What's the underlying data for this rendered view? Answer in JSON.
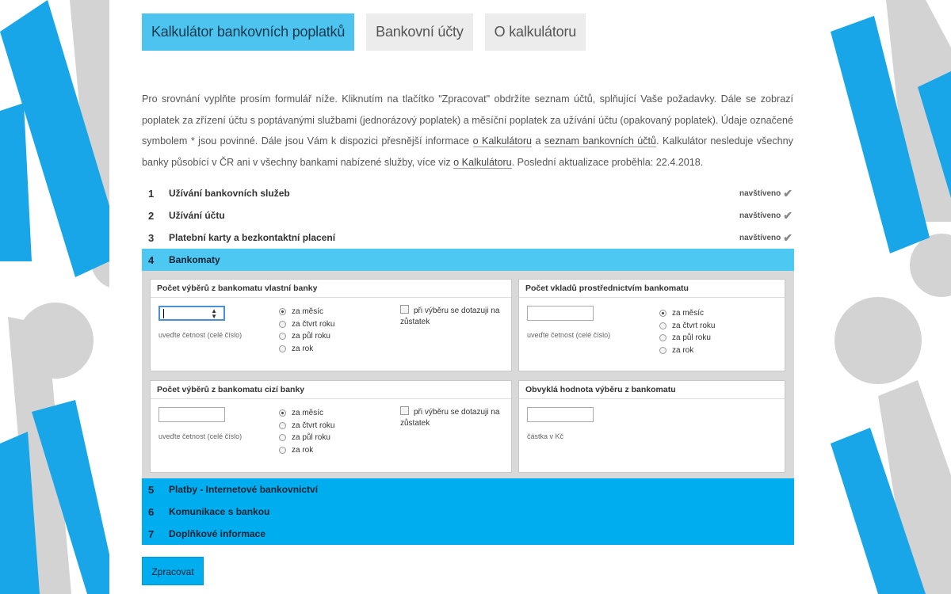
{
  "tabs": [
    {
      "label": "Kalkulátor bankovních poplatků"
    },
    {
      "label": "Bankovní účty"
    },
    {
      "label": "O kalkulátoru"
    }
  ],
  "intro": {
    "p1": "Pro srovnání vyplňte prosím formulář níže. Kliknutím na tlačítko \"Zpracovat\" obdržíte seznam účtů, splňující Vaše požadavky. Dále se zobrazí poplatek za zřízení účtu s poptávanými službami (jednorázový poplatek) a měsíční poplatek za užívání účtu (opakovaný poplatek). Údaje označené symbolem * jsou povinné. Dále jsou Vám k dispozici přesnější informace ",
    "link1": "o Kalkulátoru",
    "p2": " a ",
    "link2": "seznam bankovních účtů",
    "p3": ". Kalkulátor nesleduje všechny banky působící v ČR ani v všechny bankami nabízené služby, více viz ",
    "link3": "o Kalkulátoru",
    "p4": ". Poslední aktualizace proběhla: 22.4.2018."
  },
  "sections": [
    {
      "num": "1",
      "title": "Užívání bankovních služeb",
      "status": "navštíveno"
    },
    {
      "num": "2",
      "title": "Užívání účtu",
      "status": "navštíveno"
    },
    {
      "num": "3",
      "title": "Platební karty a bezkontaktní placení",
      "status": "navštíveno"
    },
    {
      "num": "4",
      "title": "Bankomaty"
    },
    {
      "num": "5",
      "title": "Platby - Internetové bankovnictví"
    },
    {
      "num": "6",
      "title": "Komunikace s bankou"
    },
    {
      "num": "7",
      "title": "Doplňkové informace"
    }
  ],
  "boxes": {
    "own_withdrawals": {
      "title": "Počet výběrů z bankomatu vlastní banky",
      "hint": "uveďte četnost (celé číslo)",
      "checkbox": "při výběru se dotazuji na zůstatek"
    },
    "deposits": {
      "title": "Počet vkladů prostřednictvím bankomatu",
      "hint": "uveďte četnost (celé číslo)"
    },
    "foreign_withdrawals": {
      "title": "Počet výběrů z bankomatu cizí banky",
      "hint": "uveďte četnost (celé číslo)",
      "checkbox": "při výběru se dotazuji na zůstatek"
    },
    "usual_amount": {
      "title": "Obvyklá hodnota výběru z bankomatu",
      "hint": "částka v Kč"
    }
  },
  "periods": [
    "za měsíc",
    "za čtvrt roku",
    "za půl roku",
    "za rok"
  ],
  "selected_period": "za měsíc",
  "submit_label": "Zpracovat",
  "colors": {
    "accent": "#00aeef",
    "accent_light": "#4dc8f2",
    "deco_gray": "#d0d0d0"
  }
}
